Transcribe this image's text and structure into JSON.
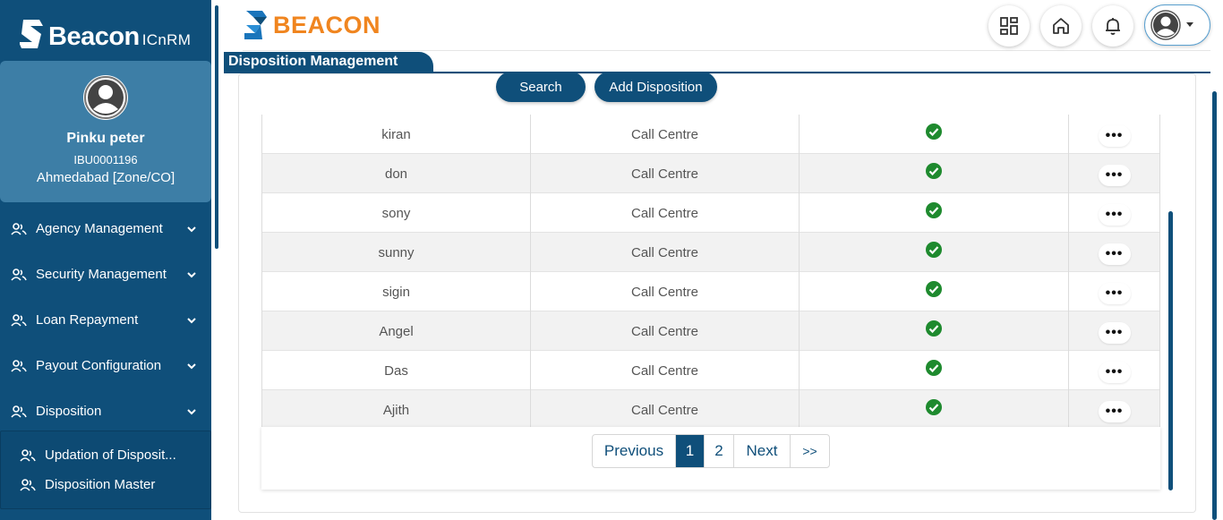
{
  "brand": {
    "name": "Beacon",
    "suffix": "ICnRM",
    "top_name": "BEACON"
  },
  "profile": {
    "name": "Pinku peter",
    "id": "IBU0001196",
    "location": "Ahmedabad [Zone/CO]"
  },
  "sidebar": {
    "items": [
      {
        "label": "Agency Management"
      },
      {
        "label": "Security Management"
      },
      {
        "label": "Loan Repayment"
      },
      {
        "label": "Payout Configuration"
      },
      {
        "label": "Disposition"
      }
    ],
    "subitems": [
      {
        "label": "Updation of Disposit..."
      },
      {
        "label": "Disposition Master"
      }
    ]
  },
  "header": {
    "icons": [
      "grid-icon",
      "home-icon",
      "bell-icon",
      "user-avatar-icon"
    ]
  },
  "page": {
    "title": "Disposition Management"
  },
  "actions": {
    "search_label": "Search",
    "add_label": "Add Disposition"
  },
  "table": {
    "rows": [
      {
        "name": "kiran",
        "type": "Call Centre",
        "active": true
      },
      {
        "name": "don",
        "type": "Call Centre",
        "active": true
      },
      {
        "name": "sony",
        "type": "Call Centre",
        "active": true
      },
      {
        "name": "sunny",
        "type": "Call Centre",
        "active": true
      },
      {
        "name": "sigin",
        "type": "Call Centre",
        "active": true
      },
      {
        "name": "Angel",
        "type": "Call Centre",
        "active": true
      },
      {
        "name": "Das",
        "type": "Call Centre",
        "active": true
      },
      {
        "name": "Ajith",
        "type": "Call Centre",
        "active": true
      }
    ],
    "menu_label": "•••"
  },
  "pagination": {
    "previous": "Previous",
    "pages": [
      "1",
      "2"
    ],
    "current": "1",
    "next": "Next",
    "last": ">>"
  },
  "colors": {
    "primary": "#0f4f7a",
    "accent": "#f0851f",
    "check": "#1e8a2e"
  }
}
